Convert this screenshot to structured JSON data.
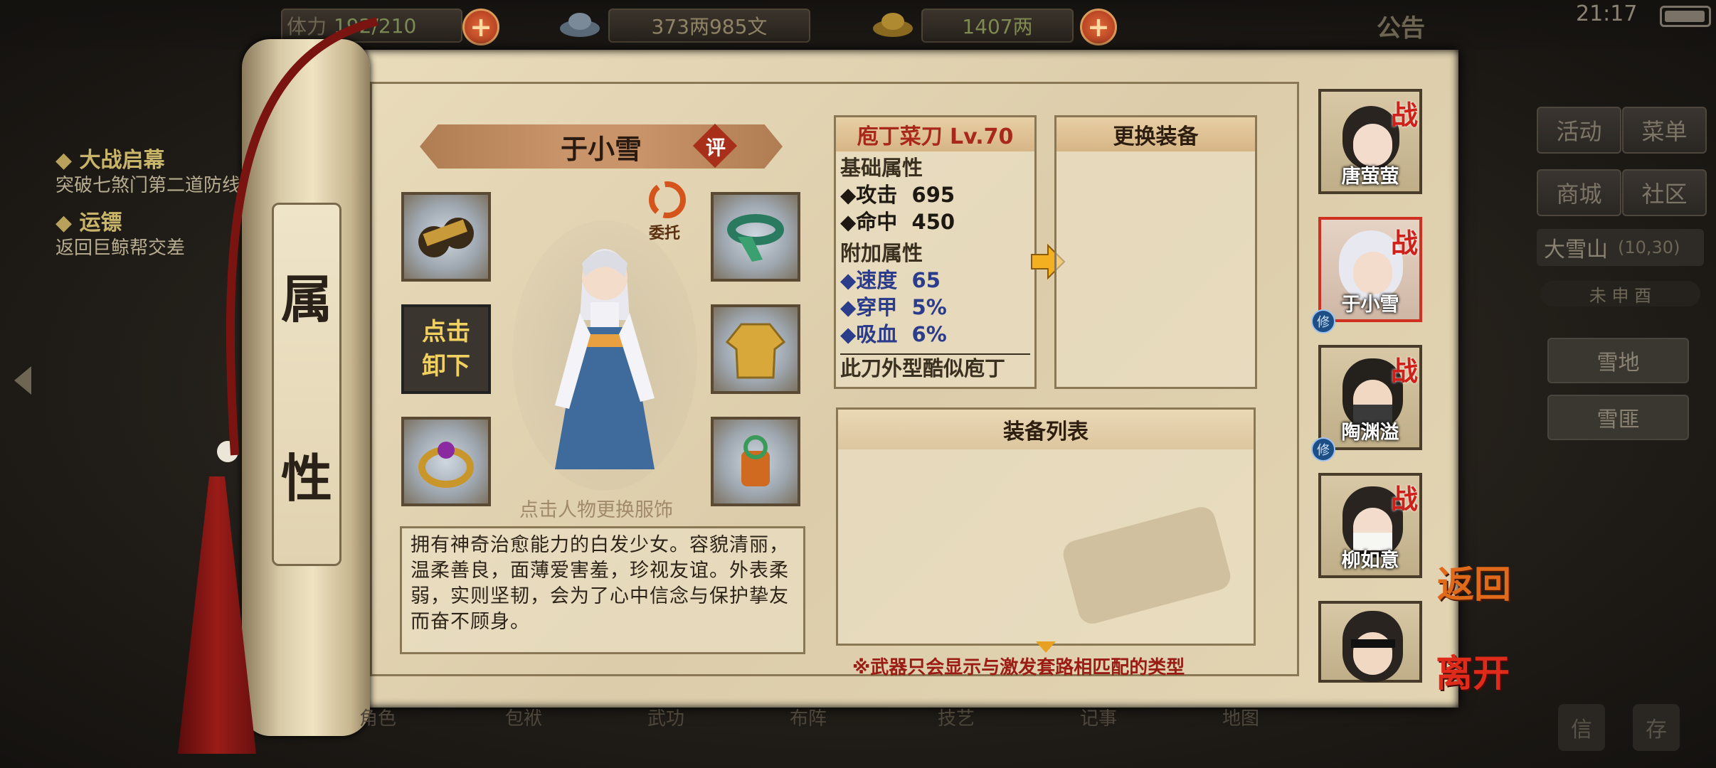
{
  "topbar": {
    "stamina_label": "体力",
    "stamina_value": "192/210",
    "copper": "373两985文",
    "gold": "1407两",
    "notice": "公告",
    "time": "21:17"
  },
  "quests": [
    {
      "title": "大战启幕",
      "desc": "突破七煞门第二道防线"
    },
    {
      "title": "运镖",
      "desc": "返回巨鲸帮交差"
    }
  ],
  "scroll_label": [
    "属",
    "性"
  ],
  "character": {
    "name": "于小雪",
    "rate_badge": "评",
    "entrust": "委托",
    "hint": "点击人物更换服饰",
    "unload_button": "点击\n卸下",
    "description": "拥有神奇治愈能力的白发少女。容貌清丽，温柔善良，面薄爱害羞，珍视友谊。外表柔弱，实则坚韧，会为了心中信念与保护挚友而奋不顾身。"
  },
  "weapon": {
    "title": "庖丁菜刀 Lv.70",
    "base_header": "基础属性",
    "base_stats": [
      {
        "name": "◆攻击",
        "value": "695"
      },
      {
        "name": "◆命中",
        "value": "450"
      }
    ],
    "extra_header": "附加属性",
    "extra_stats": [
      {
        "name": "◆速度",
        "value": "65"
      },
      {
        "name": "◆穿甲",
        "value": "5%"
      },
      {
        "name": "◆吸血",
        "value": "6%"
      }
    ],
    "flavor": "此刀外型酷似庖丁"
  },
  "replace_header": "更换装备",
  "equip_list_header": "装备列表",
  "footnote": "※武器只会显示与激发套路相匹配的类型",
  "party": [
    {
      "name": "唐萤萤",
      "badge": "战",
      "xiu": ""
    },
    {
      "name": "于小雪",
      "badge": "战",
      "xiu": "修"
    },
    {
      "name": "陶渊溢",
      "badge": "战",
      "xiu": "修"
    },
    {
      "name": "柳如意",
      "badge": "战",
      "xiu": ""
    },
    {
      "name": "",
      "badge": "",
      "xiu": ""
    }
  ],
  "side_actions": {
    "back": "返回",
    "leave": "离开"
  },
  "right_menu": {
    "activity": "活动",
    "menu": "菜单",
    "shop": "商城",
    "community": "社区",
    "location": "大雪山",
    "coords": "(10,30)",
    "compass": "未 申 酉",
    "places": [
      "雪地",
      "雪匪"
    ],
    "mail": "信",
    "save": "存"
  },
  "bottom_nav": [
    "角色",
    "包袱",
    "武功",
    "布阵",
    "技艺",
    "记事",
    "地图"
  ],
  "colors": {
    "accent_red": "#b8281c",
    "stat_blue": "#2b3c8a",
    "gold_text": "#c9b56a"
  }
}
